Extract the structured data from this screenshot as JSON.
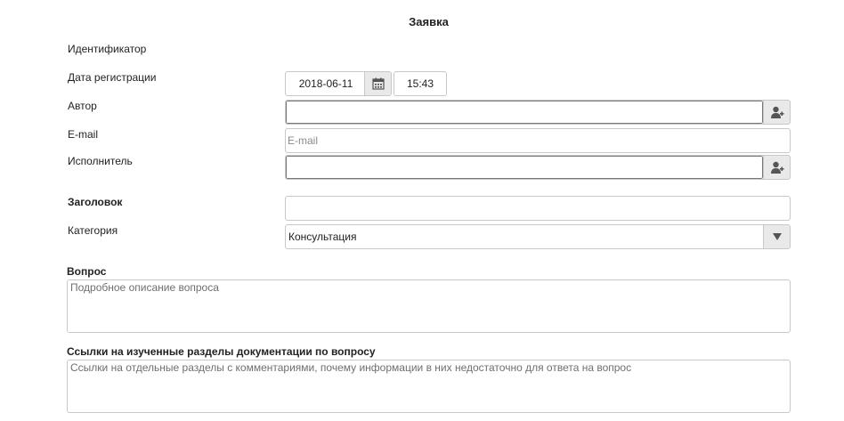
{
  "form": {
    "title": "Заявка"
  },
  "fields": {
    "identifier_label": "Идентификатор",
    "reg_date_label": "Дата регистрации",
    "reg_date_value": "2018-06-11",
    "reg_time_value": "15:43",
    "author_label": "Автор",
    "author_value": "",
    "email_label": "E-mail",
    "email_placeholder": "E-mail",
    "assignee_label": "Исполнитель",
    "assignee_value": "",
    "subject_label": "Заголовок",
    "subject_value": "",
    "category_label": "Категория",
    "category_value": "Консультация",
    "question_label": "Вопрос",
    "question_placeholder": "Подробное описание вопроса",
    "links_label": "Ссылки на изученные разделы документации по вопросу",
    "links_placeholder": "Ссылки на отдельные разделы с комментариями, почему информации в них недостаточно для ответа на вопрос"
  },
  "icons": {
    "calendar": "calendar-icon",
    "user_select": "user-select-icon",
    "dropdown": "caret-down-icon"
  },
  "colors": {
    "border": "#c8c8c8",
    "button_bg": "#e9e9e9",
    "icon": "#555555"
  }
}
